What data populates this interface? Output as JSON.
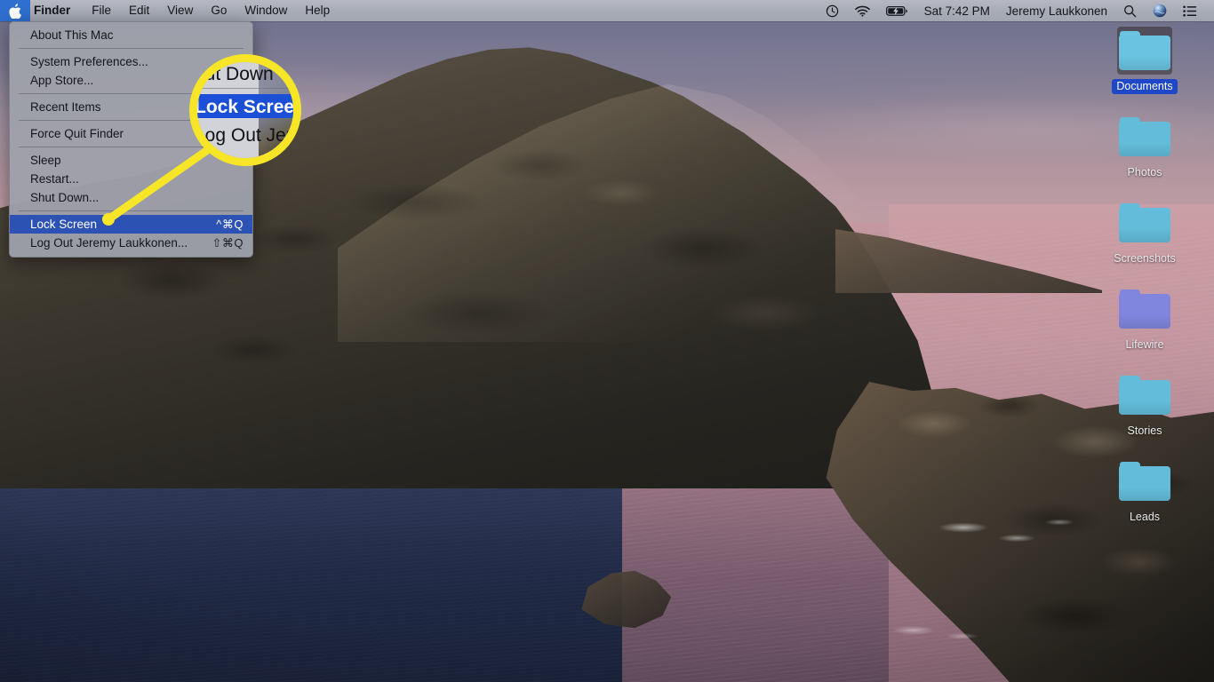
{
  "menubar": {
    "apple_icon": "apple-logo-icon",
    "left_items": [
      {
        "label": "Finder",
        "bold": true
      },
      {
        "label": "File",
        "bold": false
      },
      {
        "label": "Edit",
        "bold": false
      },
      {
        "label": "View",
        "bold": false
      },
      {
        "label": "Go",
        "bold": false
      },
      {
        "label": "Window",
        "bold": false
      },
      {
        "label": "Help",
        "bold": false
      }
    ],
    "right": {
      "time_machine_icon": "time-machine-icon",
      "wifi_icon": "wifi-icon",
      "battery_icon": "battery-charging-icon",
      "datetime": "Sat 7:42 PM",
      "user": "Jeremy Laukkonen",
      "search_icon": "search-icon",
      "siri_icon": "siri-icon",
      "control_center_icon": "control-center-icon"
    }
  },
  "apple_menu": {
    "items": [
      {
        "label": "About This Mac",
        "shortcut": "",
        "selected": false,
        "separator_after": true
      },
      {
        "label": "System Preferences...",
        "shortcut": "",
        "selected": false,
        "separator_after": false
      },
      {
        "label": "App Store...",
        "shortcut": "",
        "selected": false,
        "separator_after": true
      },
      {
        "label": "Recent Items",
        "shortcut": "",
        "selected": false,
        "separator_after": true
      },
      {
        "label": "Force Quit Finder",
        "shortcut": "",
        "selected": false,
        "separator_after": true
      },
      {
        "label": "Sleep",
        "shortcut": "",
        "selected": false,
        "separator_after": false
      },
      {
        "label": "Restart...",
        "shortcut": "",
        "selected": false,
        "separator_after": false
      },
      {
        "label": "Shut Down...",
        "shortcut": "",
        "selected": false,
        "separator_after": true
      },
      {
        "label": "Lock Screen",
        "shortcut": "^⌘Q",
        "selected": true,
        "separator_after": false
      },
      {
        "label": "Log Out Jeremy Laukkonen...",
        "shortcut": "⇧⌘Q",
        "selected": false,
        "separator_after": false
      }
    ]
  },
  "callout": {
    "highlight_color": "#f7e627",
    "magnifier": {
      "line_above": "hut Down",
      "line_selected": "Lock Screen",
      "line_below": "Log Out Jer",
      "selected_color": "#1a4fd6"
    }
  },
  "desktop_icons": [
    {
      "label": "Documents",
      "selected": true,
      "color": "#6ac3e0",
      "tab_color": "#6ac3e0"
    },
    {
      "label": "Photos",
      "selected": false,
      "color": "#63bdda",
      "tab_color": "#63bdda"
    },
    {
      "label": "Screenshots",
      "selected": false,
      "color": "#63bdda",
      "tab_color": "#63bdda"
    },
    {
      "label": "Lifewire",
      "selected": false,
      "color": "#8086de",
      "tab_color": "#8086de"
    },
    {
      "label": "Stories",
      "selected": false,
      "color": "#63bdda",
      "tab_color": "#63bdda"
    },
    {
      "label": "Leads",
      "selected": false,
      "color": "#63bdda",
      "tab_color": "#63bdda"
    }
  ]
}
